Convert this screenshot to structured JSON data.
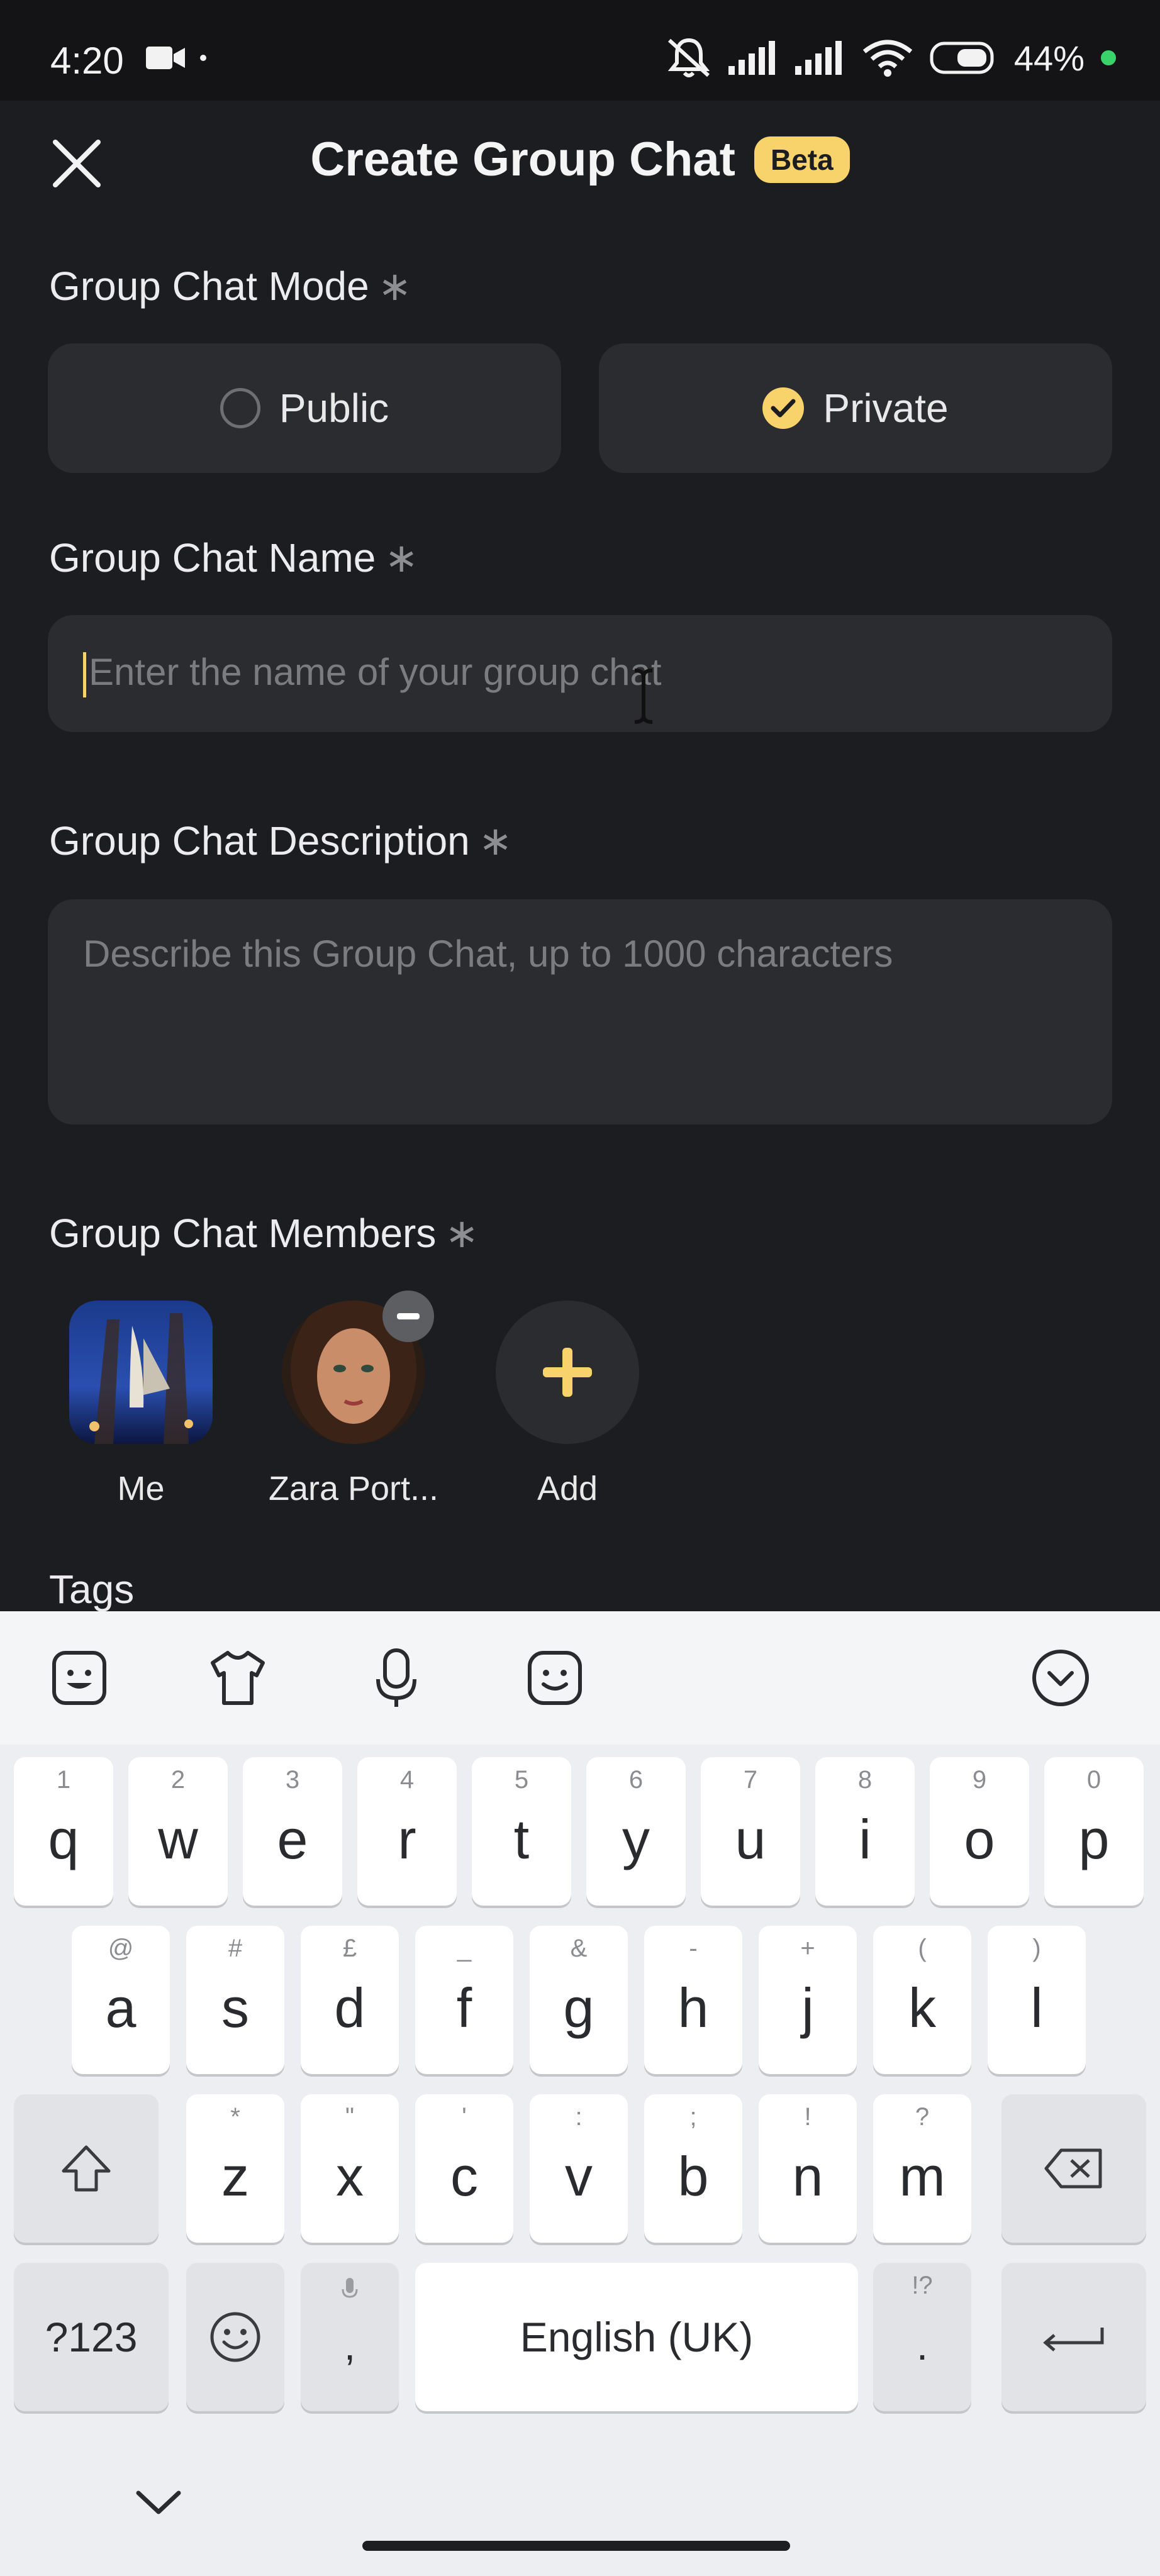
{
  "status_bar": {
    "time": "4:20",
    "battery": "44%"
  },
  "header": {
    "title": "Create Group Chat",
    "badge": "Beta"
  },
  "mode": {
    "label": "Group Chat Mode",
    "required_mark": "∗",
    "options": [
      {
        "label": "Public",
        "selected": false
      },
      {
        "label": "Private",
        "selected": true
      }
    ]
  },
  "name": {
    "label": "Group Chat Name",
    "required_mark": "∗",
    "placeholder": "Enter the name of your group chat",
    "value": ""
  },
  "description": {
    "label": "Group Chat Description",
    "required_mark": "∗",
    "placeholder": "Describe this Group Chat, up to 1000 characters",
    "value": ""
  },
  "members": {
    "label": "Group Chat Members",
    "required_mark": "∗",
    "items": [
      {
        "name": "Me"
      },
      {
        "name": "Zara Port..."
      }
    ],
    "add_label": "Add"
  },
  "tags": {
    "label": "Tags"
  },
  "keyboard": {
    "row1": [
      {
        "key": "q",
        "hint": "1"
      },
      {
        "key": "w",
        "hint": "2"
      },
      {
        "key": "e",
        "hint": "3"
      },
      {
        "key": "r",
        "hint": "4"
      },
      {
        "key": "t",
        "hint": "5"
      },
      {
        "key": "y",
        "hint": "6"
      },
      {
        "key": "u",
        "hint": "7"
      },
      {
        "key": "i",
        "hint": "8"
      },
      {
        "key": "o",
        "hint": "9"
      },
      {
        "key": "p",
        "hint": "0"
      }
    ],
    "row2": [
      {
        "key": "a",
        "hint": "@"
      },
      {
        "key": "s",
        "hint": "#"
      },
      {
        "key": "d",
        "hint": "£"
      },
      {
        "key": "f",
        "hint": "_"
      },
      {
        "key": "g",
        "hint": "&"
      },
      {
        "key": "h",
        "hint": "-"
      },
      {
        "key": "j",
        "hint": "+"
      },
      {
        "key": "k",
        "hint": "("
      },
      {
        "key": "l",
        "hint": ")"
      }
    ],
    "row3": [
      {
        "key": "z",
        "hint": "*"
      },
      {
        "key": "x",
        "hint": "\""
      },
      {
        "key": "c",
        "hint": "'"
      },
      {
        "key": "v",
        "hint": ":"
      },
      {
        "key": "b",
        "hint": ";"
      },
      {
        "key": "n",
        "hint": "!"
      },
      {
        "key": "m",
        "hint": "?"
      }
    ],
    "symbols_key": "?123",
    "comma_key": ",",
    "space_label": "English (UK)",
    "period_key": ".",
    "period_hint": "!?"
  },
  "colors": {
    "accent": "#f8d26a",
    "background": "#1c1d20",
    "surface": "#2b2c30"
  }
}
